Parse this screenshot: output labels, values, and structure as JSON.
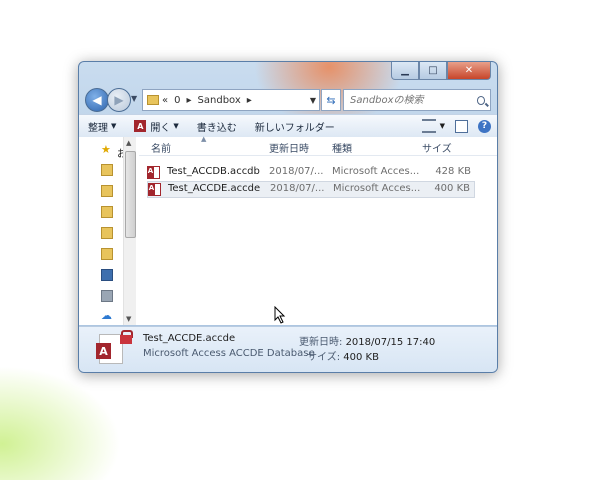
{
  "window": {
    "caption_buttons": [
      "minimize",
      "maximize",
      "close"
    ]
  },
  "address": {
    "back_icon": "back-arrow-icon",
    "forward_icon": "forward-arrow-icon",
    "breadcrumb_prefix": "«",
    "breadcrumb_parent": "0",
    "breadcrumb_current": "Sandbox"
  },
  "search": {
    "placeholder": "Sandboxの検索"
  },
  "toolbar": {
    "organize": "整理",
    "open": "開く",
    "burn": "書き込む",
    "new_folder": "新しいフォルダー"
  },
  "navpane": {
    "favorites_label": "お"
  },
  "columns": {
    "name": "名前",
    "modified": "更新日時",
    "type": "種類",
    "size": "サイズ"
  },
  "files": [
    {
      "name": "Test_ACCDB.accdb",
      "modified": "2018/07/...",
      "type": "Microsoft Acces...",
      "size": "428 KB",
      "selected": false
    },
    {
      "name": "Test_ACCDE.accde",
      "modified": "2018/07/...",
      "type": "Microsoft Acces...",
      "size": "400 KB",
      "selected": true
    }
  ],
  "details": {
    "name": "Test_ACCDE.accde",
    "type": "Microsoft Access ACCDE Database",
    "modified_label": "更新日時:",
    "modified_value": "2018/07/15 17:40",
    "size_label": "サイズ:",
    "size_value": "400 KB"
  },
  "colors": {
    "access_red": "#a2262d",
    "frame_blue": "#b8cfe6",
    "selection": "#ebeff4"
  }
}
